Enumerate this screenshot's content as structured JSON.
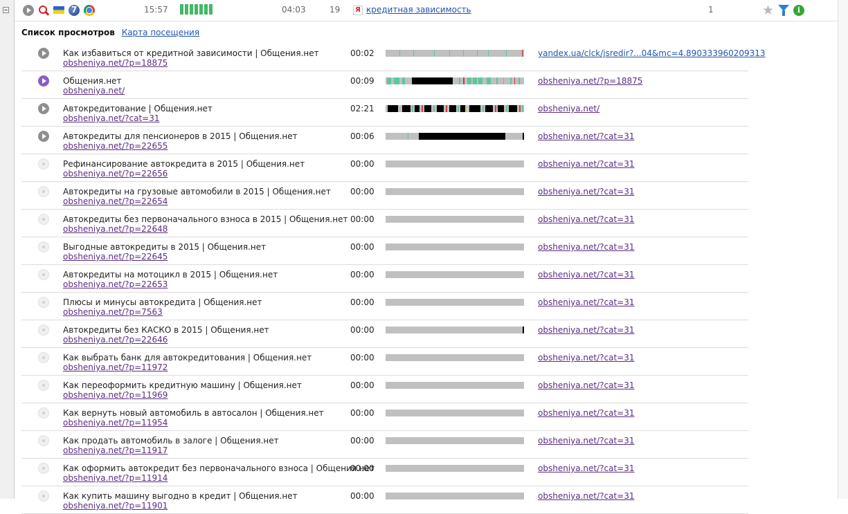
{
  "topbar": {
    "time": "15:57",
    "duration": "04:03",
    "page_count": "19",
    "query": "кредитная зависимость",
    "visits": "1",
    "icons": [
      "play-icon",
      "search-icon",
      "flag-ukraine-icon",
      "windows7-icon",
      "chrome-icon",
      "yandex-icon",
      "star-icon",
      "filter-icon",
      "info-icon"
    ]
  },
  "tabs": {
    "active": "Список просмотров",
    "link": "Карта посещения"
  },
  "bar_colors": {
    "bg": "#c0c0c0",
    "black": "#000000",
    "green": "#5fc79a",
    "red": "#d43a3a",
    "yellow": "#e8d63a"
  },
  "rows": [
    {
      "title": "Как избавиться от кредитной зависимости | Общения.нет",
      "url": "obsheniya.net/?p=18875",
      "duration": "00:02",
      "referrer": "yandex.ua/clck/jsredir?...04&mc=4.890333960209313",
      "state": "active",
      "segments": [
        {
          "s": 0.1,
          "e": 0.105,
          "c": "green"
        },
        {
          "s": 0.2,
          "e": 0.205,
          "c": "green"
        },
        {
          "s": 0.35,
          "e": 0.355,
          "c": "green"
        },
        {
          "s": 0.46,
          "e": 0.465,
          "c": "green"
        },
        {
          "s": 0.56,
          "e": 0.565,
          "c": "green"
        },
        {
          "s": 0.66,
          "e": 0.665,
          "c": "green"
        },
        {
          "s": 0.74,
          "e": 0.745,
          "c": "green"
        },
        {
          "s": 0.87,
          "e": 0.875,
          "c": "green"
        },
        {
          "s": 0.985,
          "e": 0.992,
          "c": "red"
        }
      ]
    },
    {
      "title": "Общения.нет",
      "url": "obsheniya.net/",
      "duration": "00:09",
      "referrer": "obsheniya.net/?p=18875",
      "state": "current",
      "segments": [
        {
          "s": 0.01,
          "e": 0.04,
          "c": "green"
        },
        {
          "s": 0.06,
          "e": 0.1,
          "c": "green"
        },
        {
          "s": 0.12,
          "e": 0.14,
          "c": "green"
        },
        {
          "s": 0.19,
          "e": 0.485,
          "c": "black"
        },
        {
          "s": 0.53,
          "e": 0.54,
          "c": "green"
        },
        {
          "s": 0.56,
          "e": 0.57,
          "c": "red"
        },
        {
          "s": 0.59,
          "e": 0.62,
          "c": "green"
        },
        {
          "s": 0.63,
          "e": 0.66,
          "c": "green"
        },
        {
          "s": 0.67,
          "e": 0.7,
          "c": "green"
        },
        {
          "s": 0.73,
          "e": 0.76,
          "c": "green"
        },
        {
          "s": 0.8,
          "e": 0.81,
          "c": "green"
        },
        {
          "s": 0.85,
          "e": 0.855,
          "c": "green"
        },
        {
          "s": 0.9,
          "e": 0.91,
          "c": "green"
        },
        {
          "s": 0.93,
          "e": 0.935,
          "c": "red"
        },
        {
          "s": 0.96,
          "e": 0.97,
          "c": "green"
        }
      ]
    },
    {
      "title": "Автокредитование | Общения.нет",
      "url": "obsheniya.net/?cat=31",
      "duration": "02:21",
      "referrer": "obsheniya.net/",
      "state": "active",
      "segments": [
        {
          "s": 0.015,
          "e": 0.09,
          "c": "black"
        },
        {
          "s": 0.12,
          "e": 0.18,
          "c": "black"
        },
        {
          "s": 0.19,
          "e": 0.2,
          "c": "green"
        },
        {
          "s": 0.21,
          "e": 0.245,
          "c": "black"
        },
        {
          "s": 0.26,
          "e": 0.27,
          "c": "red"
        },
        {
          "s": 0.28,
          "e": 0.33,
          "c": "black"
        },
        {
          "s": 0.345,
          "e": 0.355,
          "c": "green"
        },
        {
          "s": 0.37,
          "e": 0.42,
          "c": "black"
        },
        {
          "s": 0.435,
          "e": 0.445,
          "c": "red"
        },
        {
          "s": 0.46,
          "e": 0.51,
          "c": "black"
        },
        {
          "s": 0.52,
          "e": 0.53,
          "c": "green"
        },
        {
          "s": 0.54,
          "e": 0.575,
          "c": "black"
        },
        {
          "s": 0.585,
          "e": 0.595,
          "c": "yellow"
        },
        {
          "s": 0.605,
          "e": 0.685,
          "c": "black"
        },
        {
          "s": 0.7,
          "e": 0.71,
          "c": "green"
        },
        {
          "s": 0.72,
          "e": 0.775,
          "c": "black"
        },
        {
          "s": 0.79,
          "e": 0.8,
          "c": "red"
        },
        {
          "s": 0.81,
          "e": 0.855,
          "c": "black"
        },
        {
          "s": 0.87,
          "e": 0.88,
          "c": "green"
        },
        {
          "s": 0.89,
          "e": 0.95,
          "c": "black"
        },
        {
          "s": 0.965,
          "e": 0.975,
          "c": "red"
        },
        {
          "s": 0.985,
          "e": 0.995,
          "c": "green"
        }
      ]
    },
    {
      "title": "Автокредиты для пенсионеров в 2015 | Общения.нет",
      "url": "obsheniya.net/?p=22655",
      "duration": "00:06",
      "referrer": "obsheniya.net/?cat=31",
      "state": "active",
      "segments": [
        {
          "s": 0.085,
          "e": 0.09,
          "c": "yellow"
        },
        {
          "s": 0.16,
          "e": 0.165,
          "c": "green"
        },
        {
          "s": 0.24,
          "e": 0.865,
          "c": "black"
        },
        {
          "s": 0.99,
          "e": 1.0,
          "c": "black"
        }
      ]
    },
    {
      "title": "Рефинансирование автокредита в 2015 | Общения.нет",
      "url": "obsheniya.net/?p=22656",
      "duration": "00:00",
      "referrer": "obsheniya.net/?cat=31",
      "state": "dim",
      "segments": []
    },
    {
      "title": "Автокредиты на грузовые автомобили в 2015 | Общения.нет",
      "url": "obsheniya.net/?p=22654",
      "duration": "00:00",
      "referrer": "obsheniya.net/?cat=31",
      "state": "dim",
      "segments": []
    },
    {
      "title": "Автокредиты без первоначального взноса в 2015 | Общения.нет",
      "url": "obsheniya.net/?p=22648",
      "duration": "00:00",
      "referrer": "obsheniya.net/?cat=31",
      "state": "dim",
      "segments": []
    },
    {
      "title": "Выгодные автокредиты в 2015 | Общения.нет",
      "url": "obsheniya.net/?p=22645",
      "duration": "00:00",
      "referrer": "obsheniya.net/?cat=31",
      "state": "dim",
      "segments": []
    },
    {
      "title": "Автокредиты на мотоцикл в 2015 | Общения.нет",
      "url": "obsheniya.net/?p=22653",
      "duration": "00:00",
      "referrer": "obsheniya.net/?cat=31",
      "state": "dim",
      "segments": []
    },
    {
      "title": "Плюсы и минусы автокредита | Общения.нет",
      "url": "obsheniya.net/?p=7563",
      "duration": "00:00",
      "referrer": "obsheniya.net/?cat=31",
      "state": "dim",
      "segments": []
    },
    {
      "title": "Автокредиты без КАСКО в 2015 | Общения.нет",
      "url": "obsheniya.net/?p=22646",
      "duration": "00:00",
      "referrer": "obsheniya.net/?cat=31",
      "state": "dim",
      "segments": [
        {
          "s": 0.99,
          "e": 1.0,
          "c": "black"
        }
      ]
    },
    {
      "title": "Как выбрать банк для автокредитования | Общения.нет",
      "url": "obsheniya.net/?p=11972",
      "duration": "00:00",
      "referrer": "obsheniya.net/?cat=31",
      "state": "dim",
      "segments": []
    },
    {
      "title": "Как переоформить кредитную машину | Общения.нет",
      "url": "obsheniya.net/?p=11969",
      "duration": "00:00",
      "referrer": "obsheniya.net/?cat=31",
      "state": "dim",
      "segments": []
    },
    {
      "title": "Как вернуть новый автомобиль в автосалон | Общения.нет",
      "url": "obsheniya.net/?p=11954",
      "duration": "00:00",
      "referrer": "obsheniya.net/?cat=31",
      "state": "dim",
      "segments": []
    },
    {
      "title": "Как продать автомобиль в залоге | Общения.нет",
      "url": "obsheniya.net/?p=11917",
      "duration": "00:00",
      "referrer": "obsheniya.net/?cat=31",
      "state": "dim",
      "segments": []
    },
    {
      "title": "Как оформить автокредит без первоначального взноса | Общения.нет",
      "url": "obsheniya.net/?p=11914",
      "duration": "00:00",
      "referrer": "obsheniya.net/?cat=31",
      "state": "dim",
      "segments": []
    },
    {
      "title": "Как купить машину выгодно в кредит | Общения.нет",
      "url": "obsheniya.net/?p=11901",
      "duration": "00:00",
      "referrer": "obsheniya.net/?cat=31",
      "state": "dim",
      "segments": []
    }
  ]
}
